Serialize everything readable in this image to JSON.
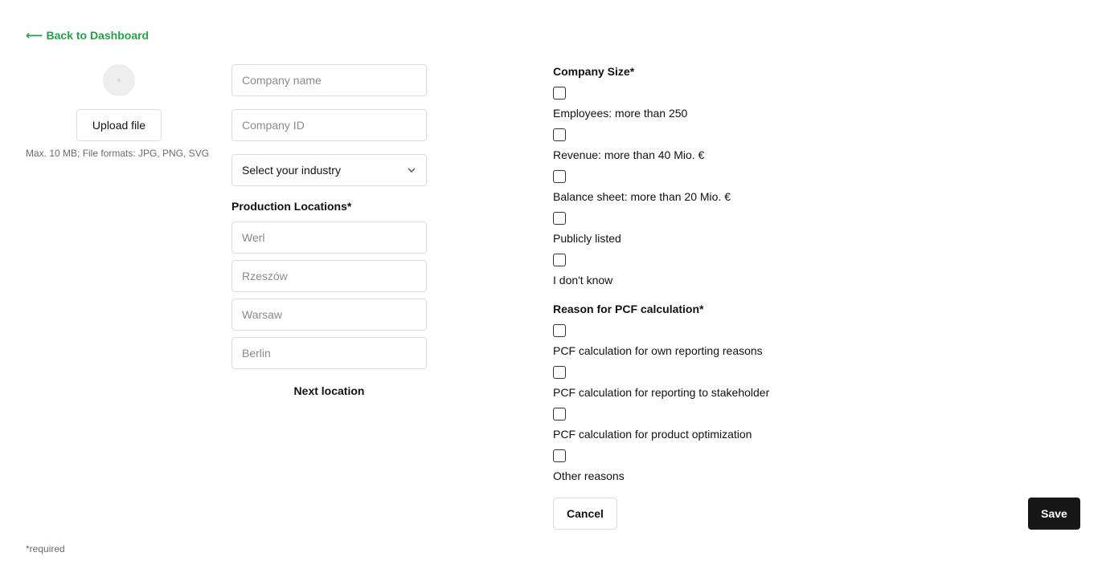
{
  "header": {
    "back_label": "Back to Dashboard"
  },
  "logo_upload": {
    "upload_label": "Upload file",
    "hint": "Max. 10 MB; File formats: JPG, PNG, SVG"
  },
  "company": {
    "name_placeholder": "Company name",
    "id_placeholder": "Company ID",
    "industry_selected": "Select your industry"
  },
  "locations": {
    "title": "Production Locations*",
    "placeholders": [
      "Werl",
      "Rzeszów",
      "Warsaw",
      "Berlin"
    ],
    "next_label": "Next location"
  },
  "company_size": {
    "title": "Company Size*",
    "options": [
      "Employees: more than 250",
      "Revenue: more than 40 Mio. €",
      "Balance sheet: more than 20 Mio. €",
      "Publicly listed",
      "I don't know"
    ]
  },
  "pcf_reason": {
    "title": "Reason for PCF calculation*",
    "options": [
      "PCF calculation for own reporting reasons",
      "PCF calculation for reporting to stakeholder",
      "PCF calculation for product optimization",
      "Other reasons"
    ]
  },
  "actions": {
    "cancel_label": "Cancel",
    "save_label": "Save"
  },
  "footer": {
    "required_note": "*required"
  },
  "colors": {
    "accent_green": "#22a34a",
    "primary_dark": "#171717"
  },
  "icons": {
    "back": "arrow-left-icon",
    "select": "chevron-down-icon"
  }
}
